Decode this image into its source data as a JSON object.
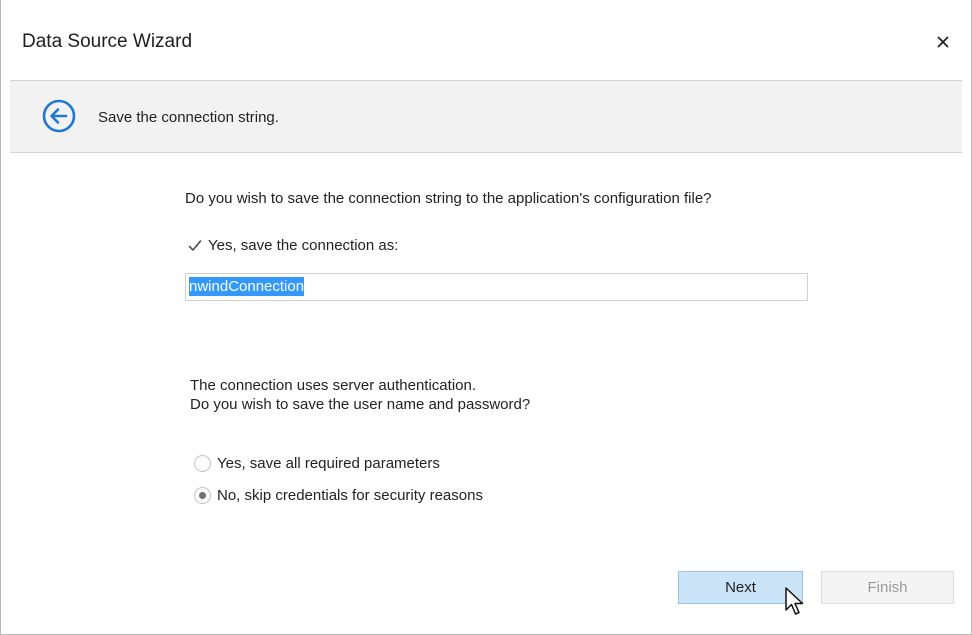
{
  "window": {
    "title": "Data Source Wizard",
    "close_icon": "close-icon"
  },
  "header": {
    "back_icon": "arrow-left-circle-icon",
    "text": "Save the connection string."
  },
  "main": {
    "question": "Do you wish to save the connection string to the application's configuration file?",
    "save_checkbox": {
      "label": "Yes, save the connection as:",
      "checked": true
    },
    "connection_name": {
      "value": "nwindConnection",
      "selected": true
    },
    "auth_line1": "The connection uses server authentication.",
    "auth_line2": "Do you wish to save the user name and password?",
    "radio_options": [
      {
        "label": "Yes, save all required parameters",
        "selected": false
      },
      {
        "label": "No, skip credentials for security reasons",
        "selected": true
      }
    ]
  },
  "footer": {
    "next_label": "Next",
    "finish_label": "Finish",
    "finish_enabled": false
  },
  "colors": {
    "accent": "#1e78d2",
    "selection": "#3399ff",
    "next_bg": "#cce4f7",
    "header_band": "#f2f2f2"
  },
  "cursor_icon": "mouse-pointer-icon"
}
